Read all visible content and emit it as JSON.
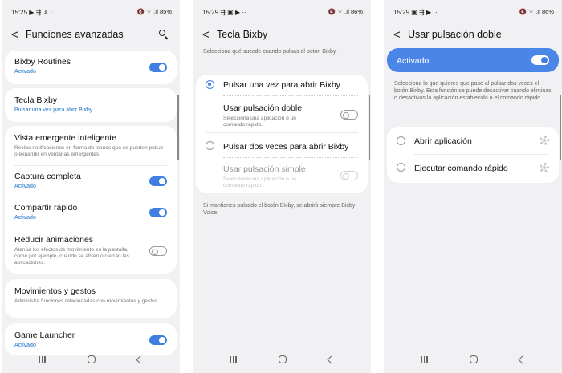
{
  "screen1": {
    "status_time": "15:25",
    "status_icons_left": "▶ ⇶ ⇓ ·",
    "status_right": "🔇 ⌔ .ıl 85%",
    "title": "Funciones avanzadas",
    "items": [
      {
        "title": "Bixby Routines",
        "subtitle": "Activado",
        "toggle": "on"
      },
      {
        "title": "Tecla Bixby",
        "subtitle": "Pulsar una vez para abrir Bixby"
      },
      {
        "title": "Vista emergente inteligente",
        "description": "Recibe notificaciones en forma de iconos que se pueden pulsar o expandir en ventanas emergentes."
      },
      {
        "title": "Captura completa",
        "subtitle": "Activado",
        "toggle": "on"
      },
      {
        "title": "Compartir rápido",
        "subtitle": "Activado",
        "toggle": "on"
      },
      {
        "title": "Reducir animaciones",
        "description": "Atenúa los efectos de movimiento en la pantalla, como por ejemplo, cuando se abren o cierran las aplicaciones.",
        "toggle": "off"
      },
      {
        "title": "Movimientos y gestos",
        "description": "Administra funciones relacionadas con movimientos y gestos."
      },
      {
        "title": "Game Launcher",
        "subtitle": "Activado",
        "toggle": "on"
      }
    ]
  },
  "screen2": {
    "status_time": "15:29",
    "status_icons_left": "⇶ ▣ ▶ ··",
    "status_right": "🔇 ⌔ .ıl 86%",
    "title": "Tecla Bixby",
    "intro": "Selecciona qué sucede cuando pulsas el botón Bixby.",
    "option1": "Pulsar una vez para abrir Bixby",
    "sub1_title": "Usar pulsación doble",
    "sub1_desc": "Selecciona una aplicación o un comando rápido.",
    "option2": "Pulsar dos veces para abrir Bixby",
    "sub2_title": "Usar pulsación simple",
    "sub2_desc": "Selecciona una aplicación o un comando rápido.",
    "footer": "Si mantienes pulsado el botón Bixby, se abrirá siempre Bixby Voice."
  },
  "screen3": {
    "status_time": "15:29",
    "status_icons_left": "▣ ⇶ ▶ ··",
    "status_right": "🔇 ⌔ .ıl 86%",
    "title": "Usar pulsación doble",
    "banner_label": "Activado",
    "intro": "Selecciona lo que quieres que pase al pulsar dos veces el botón Bixby. Esta función se puede desactivar cuando eliminas o desactivas la aplicación establecida o el comando rápido.",
    "options": [
      "Abrir aplicación",
      "Ejecutar comando rápido"
    ]
  },
  "colors": {
    "accent": "#3e7fe0",
    "banner": "#4a86e8",
    "background": "#f1f1f3"
  },
  "icons": [
    "search-icon",
    "back-arrow-icon",
    "recent-apps-icon",
    "home-icon",
    "nav-back-icon",
    "gear-icon"
  ]
}
